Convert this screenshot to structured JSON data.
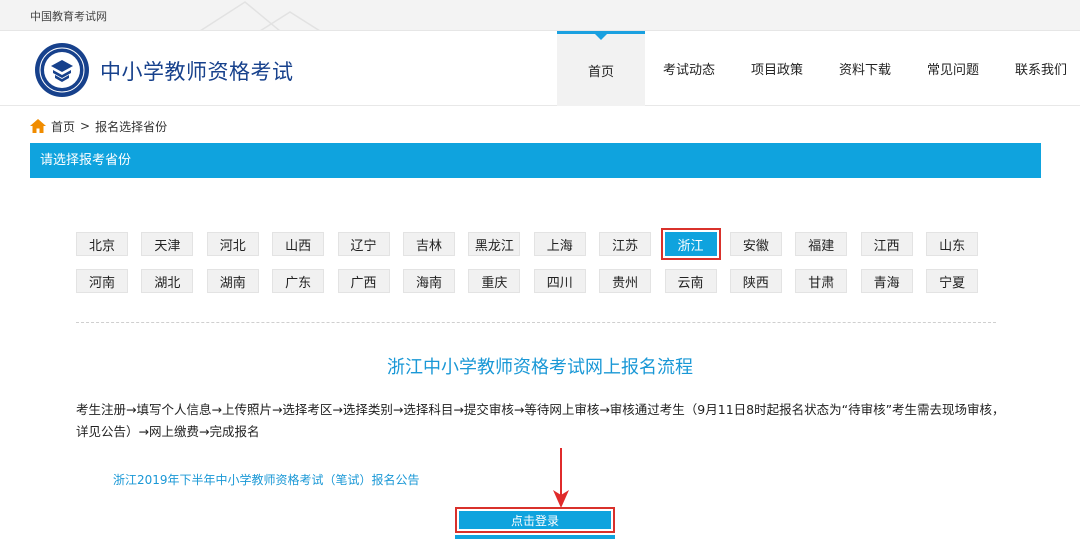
{
  "topbar": {
    "site_name": "中国教育考试网"
  },
  "header": {
    "brand": "中小学教师资格考试"
  },
  "nav": [
    {
      "label": "首页",
      "active": true
    },
    {
      "label": "考试动态",
      "active": false
    },
    {
      "label": "项目政策",
      "active": false
    },
    {
      "label": "资料下载",
      "active": false
    },
    {
      "label": "常见问题",
      "active": false
    },
    {
      "label": "联系我们",
      "active": false
    }
  ],
  "breadcrumb": {
    "home": "首页",
    "separator": ">",
    "current": "报名选择省份"
  },
  "section": {
    "title": "请选择报考省份"
  },
  "provinces": {
    "row1": [
      "北京",
      "天津",
      "河北",
      "山西",
      "辽宁",
      "吉林",
      "黑龙江",
      "上海",
      "江苏",
      "浙江",
      "安徽",
      "福建",
      "江西",
      "山东"
    ],
    "row2": [
      "河南",
      "湖北",
      "湖南",
      "广东",
      "广西",
      "海南",
      "重庆",
      "四川",
      "贵州",
      "云南",
      "陕西",
      "甘肃",
      "青海",
      "宁夏"
    ],
    "selected": "浙江"
  },
  "flow": {
    "title": "浙江中小学教师资格考试网上报名流程",
    "steps": "考生注册→填写个人信息→上传照片→选择考区→选择类别→选择科目→提交审核→等待网上审核→审核通过考生（9月11日8时起报名状态为“待审核”考生需去现场审核，详见公告）→网上缴费→完成报名"
  },
  "notice": {
    "link": "浙江2019年下半年中小学教师资格考试（笔试）报名公告"
  },
  "login": {
    "label": "点击登录"
  },
  "colors": {
    "accent": "#0fa3de",
    "brand": "#17418c",
    "highlight": "#d9312b"
  }
}
